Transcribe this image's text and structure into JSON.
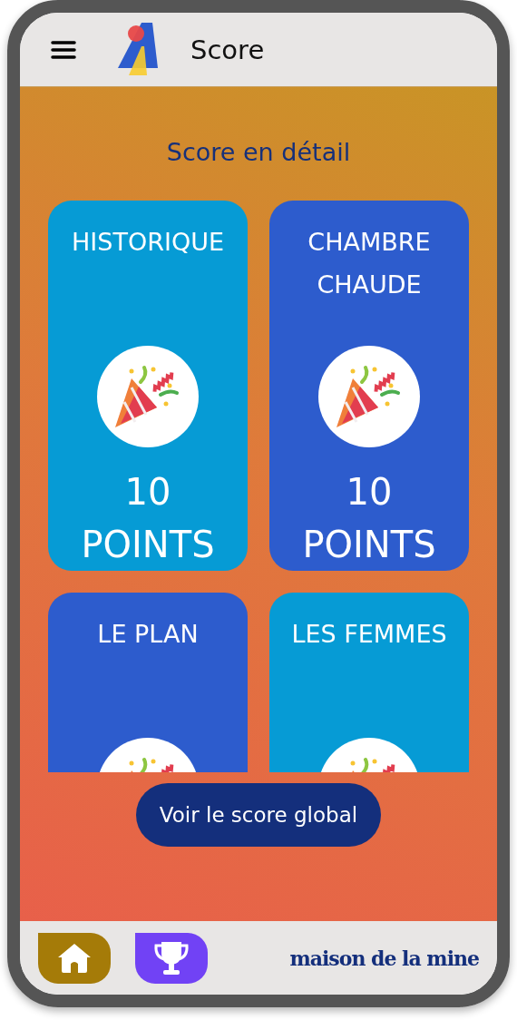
{
  "header": {
    "title": "Score"
  },
  "heading": "Score en détail",
  "cards": [
    {
      "title": "HISTORIQUE",
      "points": "10 POINTS",
      "color": "#069bd5"
    },
    {
      "title": "CHAMBRE CHAUDE",
      "points": "10 POINTS",
      "color": "#2d5ccd"
    },
    {
      "title": "LE PLAN",
      "color": "#2d5ccd"
    },
    {
      "title": "LES FEMMES",
      "color": "#069bd5"
    }
  ],
  "global_button": "Voir le score global",
  "nav": [
    {
      "kind": "home",
      "color": "#a57b08"
    },
    {
      "kind": "trophy",
      "color": "#7142f5"
    }
  ],
  "brand": "maison de la mine"
}
